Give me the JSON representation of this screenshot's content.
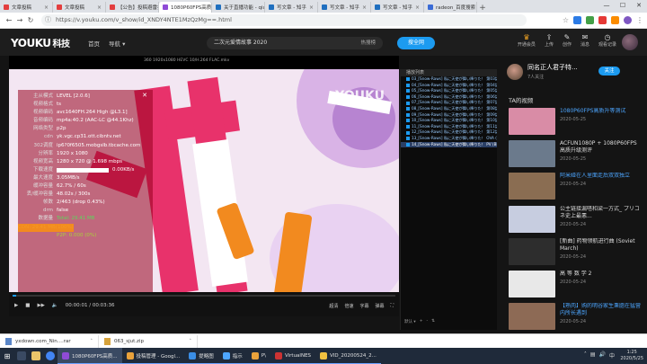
{
  "browser": {
    "tabs": [
      {
        "label": "文章投稿",
        "color": "#e33e3e"
      },
      {
        "label": "文章投稿",
        "color": "#e33e3e"
      },
      {
        "label": "【公告】投稿避雷指",
        "color": "#e33e3e"
      },
      {
        "label": "1080P60FPS高质",
        "color": "#8f4bd6",
        "active": true
      },
      {
        "label": "关于直播功能 - qiu",
        "color": "#1f6fbf"
      },
      {
        "label": "写文章 - 知乎",
        "color": "#1f6fbf"
      },
      {
        "label": "写文章 - 知乎",
        "color": "#1f6fbf"
      },
      {
        "label": "写文章 - 知乎",
        "color": "#1f6fbf"
      },
      {
        "label": "radeon_百度搜索",
        "color": "#3a6bd6"
      }
    ],
    "url": "https://v.youku.com/v_show/id_XNDY4NTE1MzQzMg==.html"
  },
  "youku": {
    "logo": "YOUKU",
    "logo_suffix": "科技",
    "nav": [
      "首页",
      "导航 ▾"
    ],
    "search_placeholder": "二次元爱情故事 2020",
    "hot_label": "热搜榜",
    "search_button": "搜全网",
    "top_icons": [
      {
        "label": "开通会员",
        "icon": "♛",
        "vip": true
      },
      {
        "label": "上传",
        "icon": "⇪"
      },
      {
        "label": "创作",
        "icon": "✎"
      },
      {
        "label": "消息",
        "icon": "✉"
      },
      {
        "label": "观看记录",
        "icon": "◷"
      }
    ]
  },
  "player": {
    "title": "360  1920x1080  HEVC 10/H.264 FLAC.mkv",
    "watermark": "YOUKU",
    "stats": {
      "header": [
        {
          "k": "主从模式",
          "v": "LEVEL [2.0.6]"
        }
      ],
      "rows": [
        {
          "k": "视频格式",
          "v": "ts",
          "c": ""
        },
        {
          "k": "视频编码",
          "v": "avc1640FH.264 High @L3.1]",
          "c": ""
        },
        {
          "k": "音频编码",
          "v": "mp4a:40.2 (AAC-LC @44.1Khz)",
          "c": ""
        },
        {
          "k": "网络类型",
          "v": "p2p",
          "c": ""
        },
        {
          "k": "cdn",
          "v": "yk.vgc.cp31.ott.cibntv.net",
          "c": ""
        },
        {
          "k": "302调度",
          "v": "ip6?0f6505.mobgslb.tbcache.com",
          "c": ""
        },
        {
          "k": "分辨率",
          "v": "1920 x 1080",
          "c": ""
        },
        {
          "k": "视频宽高",
          "v": "1280 x 720 @ 1.698 mbps",
          "c": ""
        },
        {
          "k": "下载速度",
          "v": "",
          "meter": true,
          "rv": "0.00KB/s",
          "c": ""
        },
        {
          "k": "最大速度",
          "v": "3.05MB/s",
          "c": ""
        },
        {
          "k": "缓冲容量",
          "v": "62.7% / 60s",
          "c": ""
        },
        {
          "k": "丢/缓冲容量",
          "v": "48.02s / 300s",
          "c": ""
        },
        {
          "k": "帧数",
          "v": "2/463 (drop 0.43%)",
          "c": ""
        },
        {
          "k": "drm",
          "v": "false",
          "c": ""
        },
        {
          "k": "数据量",
          "v": "Total: 29.41 MB",
          "c": "green"
        },
        {
          "k": "",
          "v": "CDN: 29.41 MB(100%)",
          "c": "orange"
        },
        {
          "k": "",
          "v": "P2P: 0.000 (0%)",
          "c": "ygreen"
        }
      ]
    },
    "controls": {
      "time": "00:00:01 / 00:03:36",
      "options": [
        "超清",
        "倍速",
        "字幕",
        "弹幕"
      ]
    },
    "progress": 0.01
  },
  "playlist": {
    "header": "播放列表",
    "items": [
      "03_[Snow-Raws] 私に天使が舞い降りた！ 第03話 (BD 1920x1080 HEVC-YUV420P10 FLAC).mkv",
      "04_[Snow-Raws] 私に天使が舞い降りた！ 第04話 (BD 1920x1080 HEVC-YUV420P10 FLAC).mkv",
      "05_[Snow-Raws] 私に天使が舞い降りた！ 第05話 (BD 1920x1080 HEVC-YUV420P10 FLAC).mkv",
      "06_[Snow-Raws] 私に天使が舞い降りた！ 第06話 (BD 1920x1080 HEVC-YUV420P10 FLAC).mkv",
      "07_[Snow-Raws] 私に天使が舞い降りた！ 第07話 (BD 1920x1080 HEVC-YUV420P10 FLAC).mkv",
      "08_[Snow-Raws] 私に天使が舞い降りた！ 第08話 (BD 1920x1080 HEVC-YUV420P10 FLAC).mkv",
      "09_[Snow-Raws] 私に天使が舞い降りた！ 第09話 (BD 1920x1080 HEVC-YUV420P10 FLAC).mkv",
      "10_[Snow-Raws] 私に天使が舞い降りた！ 第10話 (BD 1920x1080 HEVC-YUV420P10 FLAC).mkv",
      "11_[Snow-Raws] 私に天使が舞い降りた！ 第11話 (BD 1920x1080 HEVC-YUV420P10 FLAC).mkv",
      "12_[Snow-Raws] 私に天使が舞い降りた！ 第12話 (BD 1920x1080 HEVC-YUV420P10 FLAC).mkv",
      "13_[Snow-Raws] 私に天使が舞い降りた！ OVA (BD 1920x1080 HEVC-YUV420P10 FLAC).mkv",
      "14_[Snow-Raws] 私に天使が舞い降りた！ PV (BD 1920x1080 HEVC-YUV420P10 FLAC).mkv"
    ],
    "selected": 11,
    "footer": [
      "默认 ▾",
      "+",
      "-",
      "⇅"
    ]
  },
  "channel": {
    "name": "同名正人君子特...",
    "subs": "7人关注",
    "follow": "关注"
  },
  "related": {
    "title": "TA的视频",
    "videos": [
      {
        "title": "1080P60FPS高质升等测试",
        "date": "2020-05-25",
        "thumb": "#d98ca6",
        "hl": true
      },
      {
        "title": "ACFUN1080P + 1080P60FPS高质升级测评",
        "date": "2020-05-25",
        "thumb": "#6b7a8c"
      },
      {
        "title": "阿米娅在人里面走后双双独立",
        "date": "2020-05-24",
        "thumb": "#8a6d52",
        "hl": true
      },
      {
        "title": "公主链接漏嗒和梁一方式_ プリコネ史上最悪...",
        "date": "2020-05-24",
        "thumb": "#c7cde0"
      },
      {
        "title": "[新曲] 药物领航进行曲 (Soviet March)",
        "date": "2020-05-24",
        "thumb": "#2d2d2d"
      },
      {
        "title": "高 等 数 学 2",
        "date": "2020-05-24",
        "thumb": "#e8e8e8"
      },
      {
        "title": "【熟肉】购的明谷家生秉脂在猛营内所长遇到",
        "date": "2020-05-24",
        "thumb": "#8d6a55",
        "hl": true
      }
    ]
  },
  "downloads": [
    {
      "name": "yxdown.com_Nin....rar",
      "kind": "rar"
    },
    {
      "name": "063_sjut.zip",
      "kind": "zip"
    }
  ],
  "taskbar": {
    "tasks": [
      {
        "label": "1080P60FPS高质...",
        "color": "#8f4bd6",
        "active": true
      },
      {
        "label": "投稿管理 - Googl...",
        "color": "#e9a23b"
      },
      {
        "label": "提略图",
        "color": "#3a8ee6"
      },
      {
        "label": "指示",
        "color": "#4da6ff"
      },
      {
        "label": "P\\",
        "color": "#e9a23b"
      },
      {
        "label": "VirtualNES",
        "color": "#cc3333"
      },
      {
        "label": "VID_20200524_2...",
        "color": "#f0c040"
      }
    ],
    "time": "1:25",
    "date": "2020/5/25"
  }
}
